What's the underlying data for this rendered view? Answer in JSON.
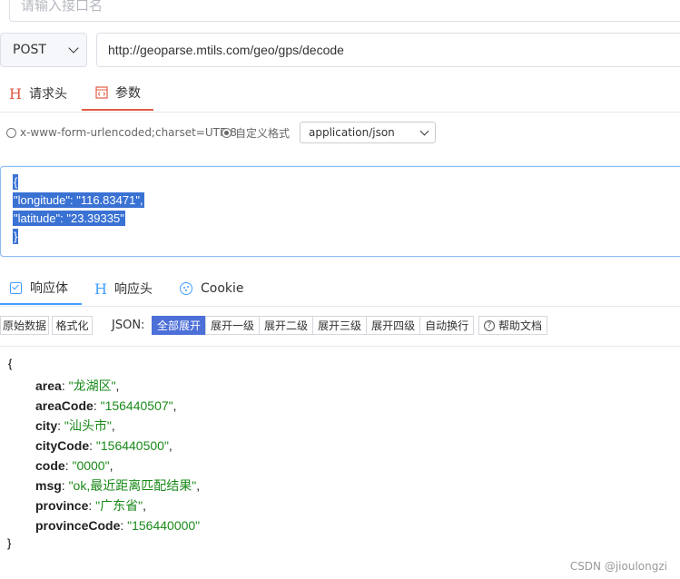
{
  "api_name": {
    "placeholder": "请输入接口名"
  },
  "request": {
    "method": "POST",
    "url": "http://geoparse.mtils.com/geo/gps/decode"
  },
  "request_tabs": [
    {
      "label": "请求头",
      "icon": "h-icon"
    },
    {
      "label": "参数",
      "icon": "code-icon",
      "active": true
    }
  ],
  "content_type": {
    "option_form": "x-www-form-urlencoded;charset=UTF-8",
    "option_custom": "自定义格式",
    "selected": "custom",
    "select_value": "application/json"
  },
  "body_lines": [
    "{",
    "\"longitude\": \"116.83471\",",
    "\"latitude\": \"23.39335\"",
    "}"
  ],
  "response_tabs": [
    {
      "label": "响应体",
      "icon": "check-square-icon",
      "active": true
    },
    {
      "label": "响应头",
      "icon": "h-icon"
    },
    {
      "label": "Cookie",
      "icon": "cookie-icon"
    }
  ],
  "toolbar": {
    "raw": "原始数据",
    "format": "格式化",
    "json_label": "JSON:",
    "expand_all": "全部展开",
    "expand_1": "展开一级",
    "expand_2": "展开二级",
    "expand_3": "展开三级",
    "expand_4": "展开四级",
    "auto_wrap": "自动换行",
    "help": "帮助文档"
  },
  "response": {
    "open": "{",
    "close": "}",
    "fields": [
      {
        "key": "area",
        "value": "\"龙湖区\""
      },
      {
        "key": "areaCode",
        "value": "\"156440507\""
      },
      {
        "key": "city",
        "value": "\"汕头市\""
      },
      {
        "key": "cityCode",
        "value": "\"156440500\""
      },
      {
        "key": "code",
        "value": "\"0000\""
      },
      {
        "key": "msg",
        "value": "\"ok,最近距离匹配结果\""
      },
      {
        "key": "province",
        "value": "\"广东省\""
      },
      {
        "key": "provinceCode",
        "value": "\"156440000\""
      }
    ]
  },
  "colors": {
    "accent_tab": "#e25b45",
    "blue": "#409eff",
    "json_value": "#1a8a1a",
    "active_button": "#4c6fd8"
  },
  "watermark": "CSDN @jioulongzi"
}
